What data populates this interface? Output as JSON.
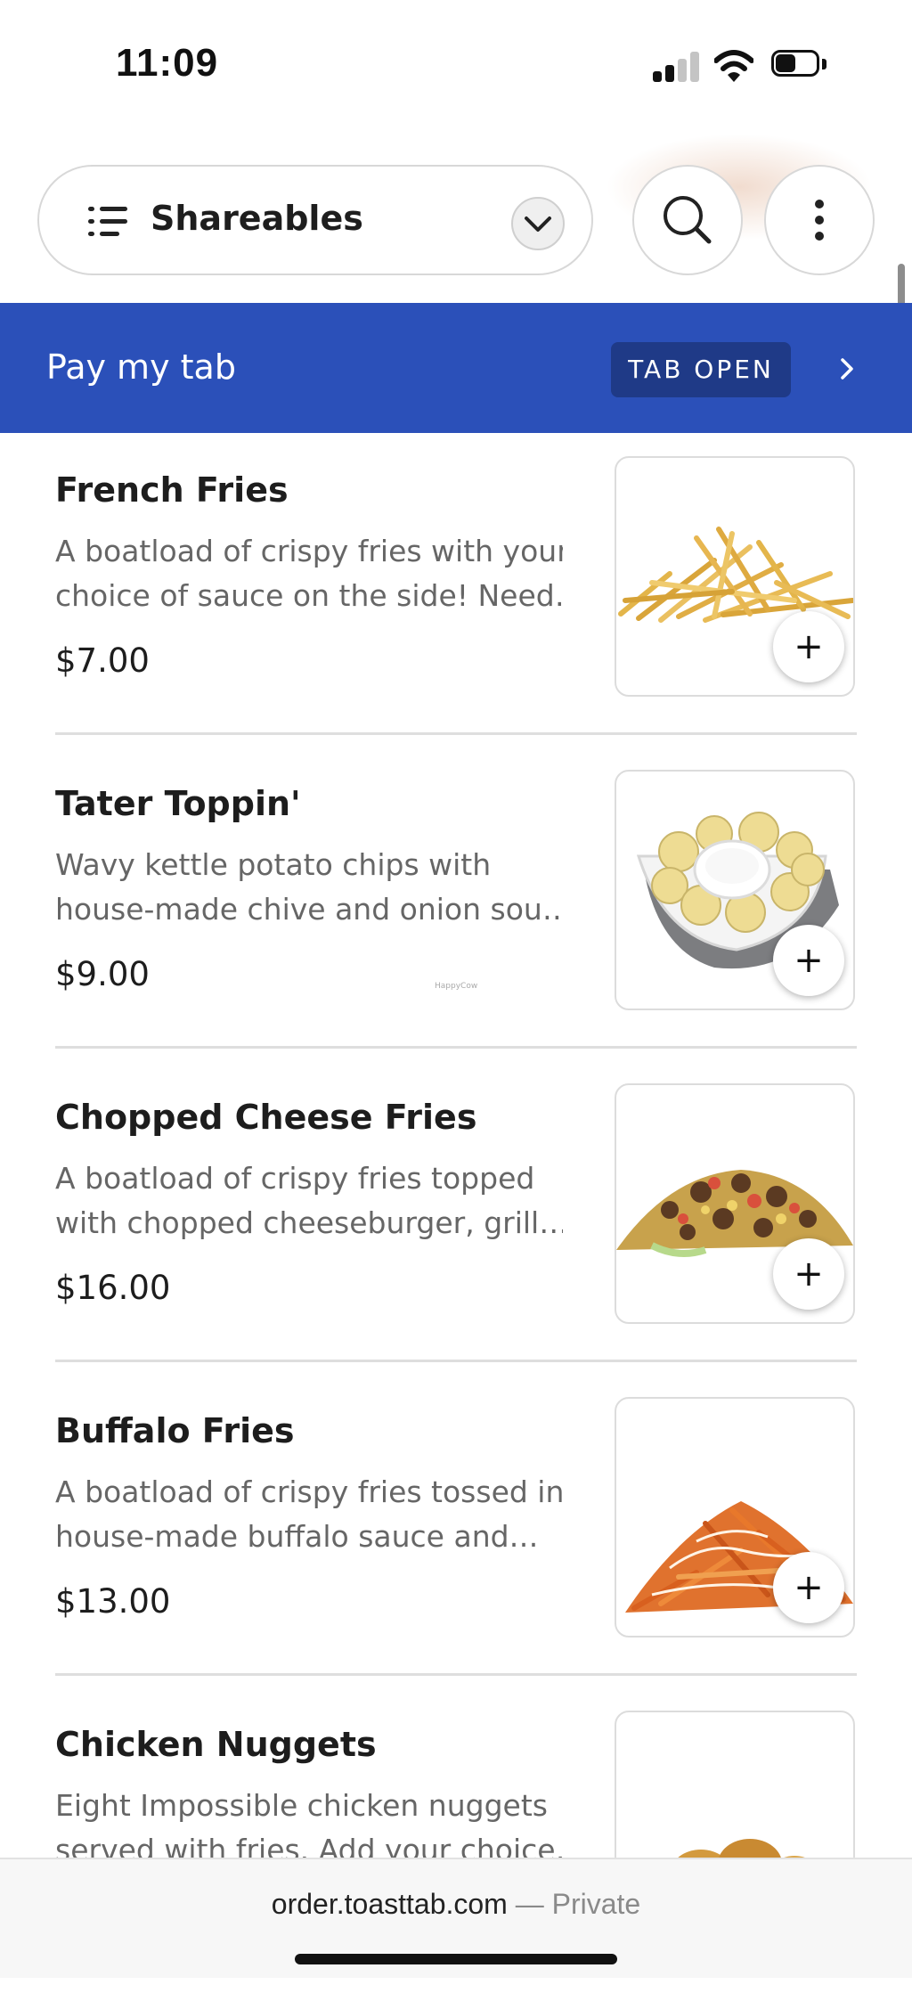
{
  "status_bar": {
    "time": "11:09"
  },
  "header": {
    "category_label": "Shareables"
  },
  "tab_banner": {
    "label": "Pay my tab",
    "badge": "TAB OPEN"
  },
  "menu": {
    "items": [
      {
        "name": "French Fries",
        "desc_line1": "A boatload of crispy fries with your",
        "desc_line2": "choice of sauce on the side! Need…",
        "price": "$7.00",
        "add_label": "+"
      },
      {
        "name": "Tater Toppin'",
        "desc_line1": "Wavy kettle potato chips with",
        "desc_line2": "house-made chive and onion sou…",
        "price": "$9.00",
        "add_label": "+"
      },
      {
        "name": "Chopped Cheese Fries",
        "desc_line1": "A boatload of crispy fries topped",
        "desc_line2": "with chopped cheeseburger, grill…",
        "price": "$16.00",
        "add_label": "+"
      },
      {
        "name": "Buffalo Fries",
        "desc_line1": "A boatload of crispy fries tossed in",
        "desc_line2": "house-made buffalo sauce and…",
        "price": "$13.00",
        "add_label": "+"
      },
      {
        "name": "Chicken Nuggets",
        "desc_line1": "Eight Impossible chicken nuggets",
        "desc_line2": "served with fries. Add your choice…",
        "price": "",
        "add_label": "+"
      }
    ],
    "watermark": "HappyCow"
  },
  "browser": {
    "domain": "order.toasttab.com",
    "separator": "—",
    "private_label": "Private"
  },
  "colors": {
    "accent_blue": "#2b50b9",
    "badge_blue": "#1f3a87",
    "text_dark": "#1d1d1d",
    "text_muted": "#666666"
  }
}
